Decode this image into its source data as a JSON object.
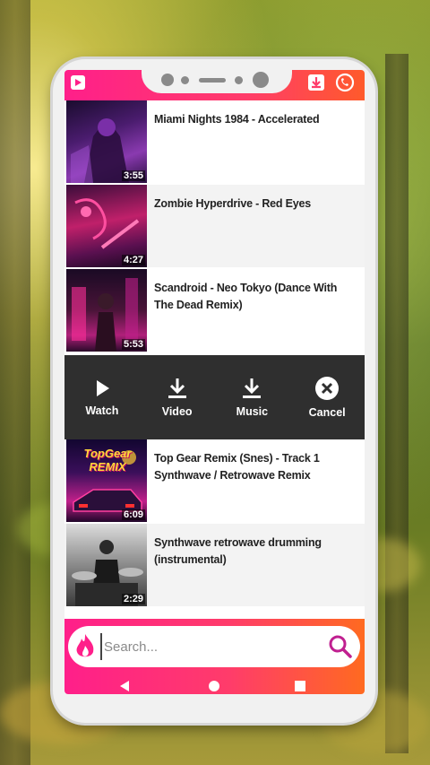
{
  "videos_top": [
    {
      "title": "Miami Nights 1984 - Accelerated",
      "duration": "3:55"
    },
    {
      "title": "Zombie Hyperdrive - Red Eyes",
      "duration": "4:27"
    },
    {
      "title": "Scandroid - Neo Tokyo (Dance With The Dead Remix)",
      "duration": "5:53"
    }
  ],
  "actions": {
    "watch": "Watch",
    "video": "Video",
    "music": "Music",
    "cancel": "Cancel"
  },
  "videos_bottom": [
    {
      "title": "Top Gear Remix (Snes) - Track 1 Synthwave / Retrowave Remix",
      "duration": "6:09",
      "thumb_text": "TopGear REMIX"
    },
    {
      "title": "Synthwave retrowave drumming (instrumental)",
      "duration": "2:29"
    }
  ],
  "search": {
    "placeholder": "Search..."
  },
  "colors": {
    "accent_pink": "#ff1f8a",
    "accent_orange": "#ff6a20",
    "action_bar": "#2f2f2f"
  }
}
